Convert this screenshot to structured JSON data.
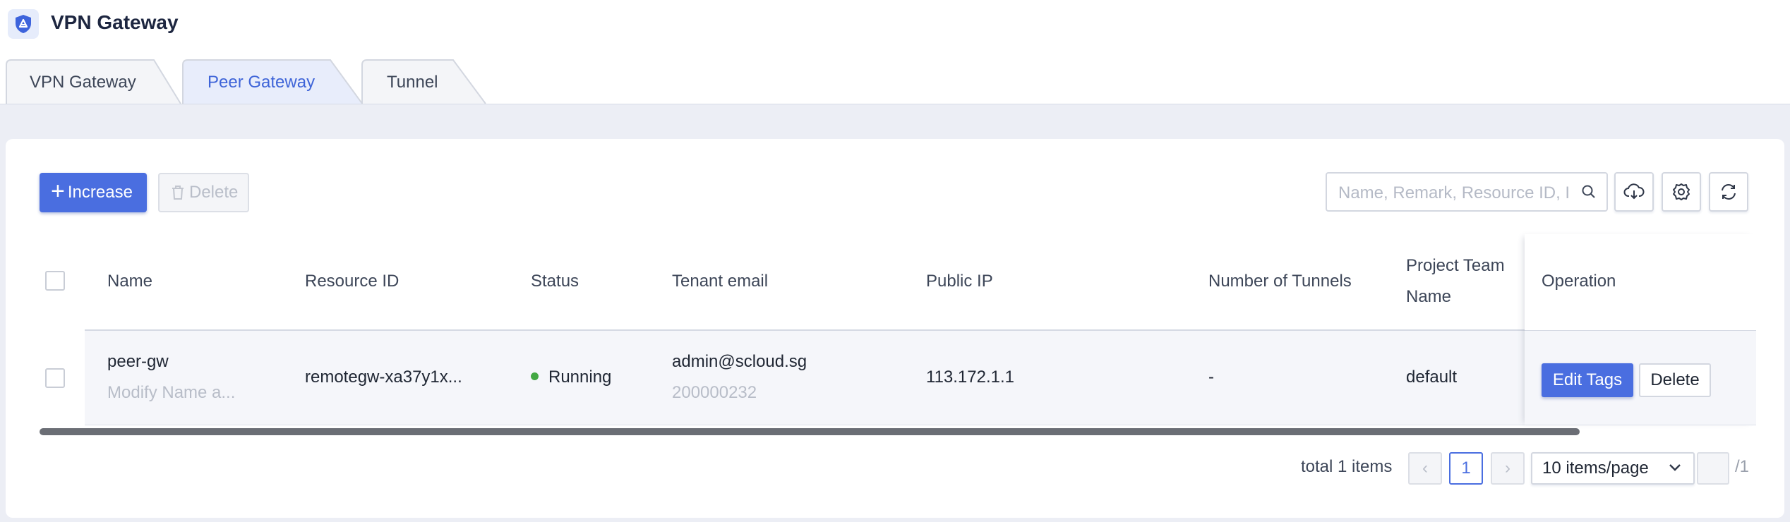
{
  "app": {
    "title": "VPN Gateway"
  },
  "tabs": [
    {
      "label": "VPN Gateway",
      "active": false
    },
    {
      "label": "Peer Gateway",
      "active": true
    },
    {
      "label": "Tunnel",
      "active": false
    }
  ],
  "toolbar": {
    "increase_label": "Increase",
    "delete_label": "Delete",
    "search_placeholder": "Name, Remark, Resource ID, IP",
    "icons": [
      "cloud-download-icon",
      "settings-gear-icon",
      "refresh-icon"
    ]
  },
  "table": {
    "columns": {
      "name": "Name",
      "resource_id": "Resource ID",
      "status": "Status",
      "tenant_email": "Tenant email",
      "public_ip": "Public IP",
      "num_tunnels": "Number of Tunnels",
      "project_team_line1": "Project Team",
      "project_team_line2": "Name",
      "operation": "Operation"
    },
    "rows": [
      {
        "name": "peer-gw",
        "name_sub": "Modify Name a...",
        "resource_id": "remotegw-xa37y1x...",
        "status": "Running",
        "tenant_email": "admin@scloud.sg",
        "tenant_sub": "200000232",
        "public_ip": "113.172.1.1",
        "num_tunnels": "-",
        "project_team": "default",
        "op_edit": "Edit Tags",
        "op_delete": "Delete"
      }
    ]
  },
  "pagination": {
    "total": "total 1 items",
    "prev": "‹",
    "current_page": "1",
    "next": "›",
    "page_size": "10 items/page",
    "of_pages": "/1"
  },
  "colors": {
    "primary": "#4a6ee0",
    "status_running": "#43a843",
    "background": "#eceef5"
  }
}
